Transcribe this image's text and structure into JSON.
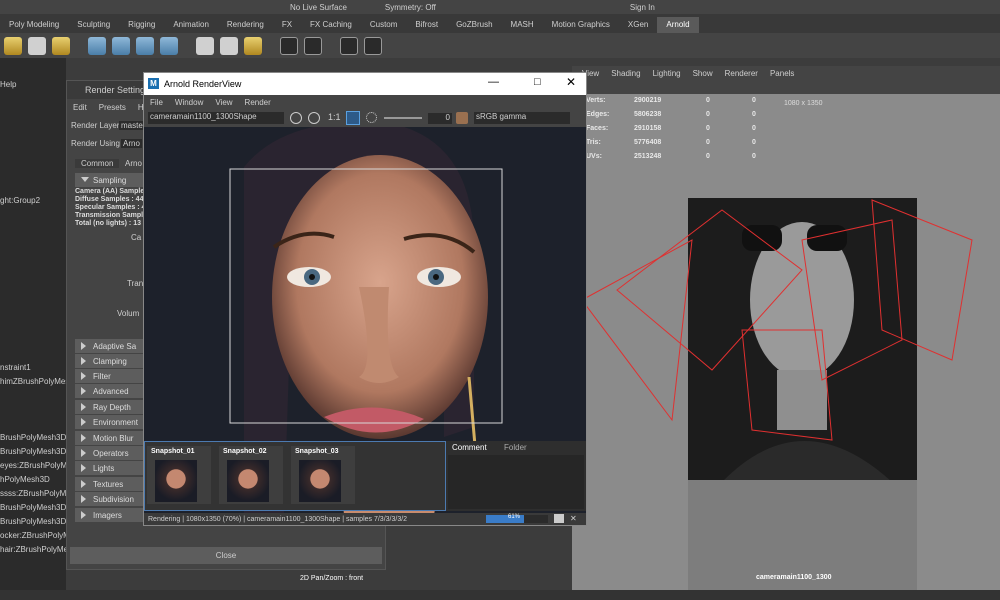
{
  "topbar": {
    "items": [
      "No Live Surface",
      "Symmetry: Off",
      "Sign In"
    ]
  },
  "shelf": {
    "tabs": [
      "Poly Modeling",
      "Sculpting",
      "Rigging",
      "Animation",
      "Rendering",
      "FX",
      "FX Caching",
      "Custom",
      "Bifrost",
      "GoZBrush",
      "MASH",
      "Motion Graphics",
      "XGen",
      "Arnold"
    ],
    "active": "Arnold"
  },
  "outliner": {
    "items": [
      "Help",
      "ght:Group2",
      "nstraint1",
      "himZBrushPolyMesh",
      "BrushPolyMesh3D",
      "BrushPolyMesh3D",
      "eyes:ZBrushPolyMe",
      "hPolyMesh3D",
      "ssss:ZBrushPolyMe",
      "BrushPolyMesh3D",
      "BrushPolyMesh3D",
      "ocker:ZBrushPolyMe",
      "hair:ZBrushPolyMe"
    ]
  },
  "render_settings": {
    "title": "Render Settings",
    "menu": [
      "Edit",
      "Presets",
      "He"
    ],
    "render_layer_label": "Render Layer",
    "render_layer_value": "maste",
    "render_using_label": "Render Using",
    "render_using_value": "Arno",
    "tabs": [
      "Common",
      "Arno"
    ],
    "sampling_label": "Sampling",
    "sampling_lines": [
      "Camera (AA) Sample",
      "Diffuse Samples : 44",
      "Specular Samples : 4",
      "Transmission Sample",
      "Total (no lights) : 13"
    ],
    "side_labels": [
      "Ca",
      "Tran",
      "Volum"
    ],
    "sections": [
      "Adaptive Sa",
      "Clamping",
      "Filter",
      "Advanced",
      "Ray Depth",
      "Environment",
      "Motion Blur",
      "Operators",
      "Lights",
      "Textures",
      "Subdivision",
      "Imagers"
    ],
    "close_label": "Close"
  },
  "arnold": {
    "title": "Arnold RenderView",
    "menu": [
      "File",
      "Window",
      "View",
      "Render"
    ],
    "camera": "cameramain1100_1300Shape",
    "ratio": "1:1",
    "exposure": "0",
    "color_space": "sRGB gamma",
    "snapshots": [
      "Snapshot_01",
      "Snapshot_02",
      "Snapshot_03"
    ],
    "comment_tab": "Comment",
    "folder_tab": "Folder",
    "status": "Rendering | 1080x1350 (70%) | cameramain1100_1300Shape | samples 7/3/3/3/3/2",
    "progress": 0.61,
    "progress_label": "61%"
  },
  "viewport": {
    "menu": [
      "View",
      "Shading",
      "Lighting",
      "Show",
      "Renderer",
      "Panels"
    ],
    "resolution": "1080 x 1350",
    "stats": [
      {
        "label": "Verts:",
        "a": "2900219",
        "b": "0",
        "c": "0"
      },
      {
        "label": "Edges:",
        "a": "5806238",
        "b": "0",
        "c": "0"
      },
      {
        "label": "Faces:",
        "a": "2910158",
        "b": "0",
        "c": "0"
      },
      {
        "label": "Tris:",
        "a": "5776408",
        "b": "0",
        "c": "0"
      },
      {
        "label": "UVs:",
        "a": "2513248",
        "b": "0",
        "c": "0"
      }
    ],
    "camera_label": "cameramain1100_1300",
    "pan_zoom": "2D Pan/Zoom : front"
  }
}
